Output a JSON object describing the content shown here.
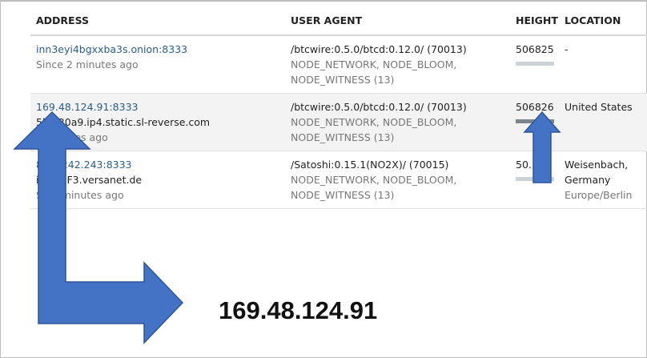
{
  "table": {
    "headers": {
      "address": "ADDRESS",
      "user_agent": "USER AGENT",
      "height": "HEIGHT",
      "location": "LOCATION"
    },
    "rows": [
      {
        "address": "inn3eyi4bgxxba3s.onion:8333",
        "host": "",
        "since": "Since 2 minutes ago",
        "user_agent": "/btcwire:0.5.0/btcd:0.12.0/ (70013)",
        "services_1": "NODE_NETWORK, NODE_BLOOM,",
        "services_2": "NODE_WITNESS (13)",
        "height": "506825",
        "location": "-",
        "timezone": ""
      },
      {
        "address": "169.48.124.91:8333",
        "host": "5b...30a9.ip4.static.sl-reverse.com",
        "since": "...minutes ago",
        "user_agent": "/btcwire:0.5.0/btcd:0.12.0/ (70013)",
        "services_1": "NODE_NETWORK, NODE_BLOOM,",
        "services_2": "NODE_WITNESS (13)",
        "height": "506826",
        "location": "United States",
        "timezone": ""
      },
      {
        "address": "8...5.242.243:8333",
        "host": "i5...F2F3.versanet.de",
        "since": "S...3 minutes ago",
        "user_agent": "/Satoshi:0.15.1(NO2X)/ (70015)",
        "services_1": "NODE_NETWORK, NODE_BLOOM,",
        "services_2": "NODE_WITNESS (13)",
        "height": "50...25",
        "location": "Weisenbach,",
        "location_2": "Germany",
        "timezone": "Europe/Berlin"
      }
    ]
  },
  "annotation": {
    "ip_text": "169.48.124.91"
  },
  "colors": {
    "arrow": "#4472c4",
    "arrow_stroke": "#2f5597",
    "link": "#2a5d8a"
  }
}
